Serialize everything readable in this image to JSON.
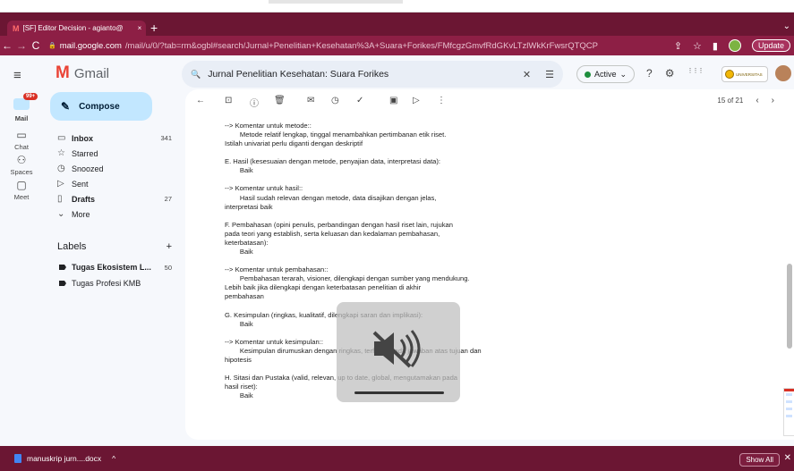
{
  "browser": {
    "tab_title": "[SF] Editor Decision - agianto@",
    "tab_close": "×",
    "new_tab": "+",
    "tab_menu": "⌄",
    "back": "←",
    "forward": "→",
    "reload": "C",
    "lock": "🔒",
    "url_host": "mail.google.com",
    "url_path": "/mail/u/0/?tab=rm&ogbl#search/Jurnal+Penelitian+Kesehatan%3A+Suara+Forikes/FMfcgzGmvfRdGKvLTzlWkKrFwsrQTQCP",
    "update_label": "Update",
    "share_icon": "⇪",
    "star_icon": "☆",
    "sidebar_icon": "▮",
    "menu_icon": "⋮"
  },
  "rail": {
    "menu": "≡",
    "mail_badge": "99+",
    "items": [
      {
        "icon": "✉",
        "label": "Mail"
      },
      {
        "icon": "▭",
        "label": "Chat"
      },
      {
        "icon": "⚇",
        "label": "Spaces"
      },
      {
        "icon": "▢",
        "label": "Meet"
      }
    ]
  },
  "gmail": {
    "logo_m": "M",
    "logo_text": "Gmail",
    "compose_icon": "✎",
    "compose_label": "Compose",
    "folders": [
      {
        "icon": "▭",
        "label": "Inbox",
        "count": "341",
        "bold": true
      },
      {
        "icon": "☆",
        "label": "Starred",
        "count": "",
        "bold": false
      },
      {
        "icon": "◷",
        "label": "Snoozed",
        "count": "",
        "bold": false
      },
      {
        "icon": "▷",
        "label": "Sent",
        "count": "",
        "bold": false
      },
      {
        "icon": "▯",
        "label": "Drafts",
        "count": "27",
        "bold": true
      },
      {
        "icon": "⌄",
        "label": "More",
        "count": "",
        "bold": false
      }
    ],
    "labels_title": "Labels",
    "labels_add": "+",
    "labels": [
      {
        "name": "Tugas Ekosistem L...",
        "count": "50",
        "bold": true
      },
      {
        "name": "Tugas Profesi KMB",
        "count": "",
        "bold": false
      }
    ]
  },
  "header": {
    "search_icon": "🔍",
    "search_query": "Jurnal Penelitian Kesehatan: Suara Forikes",
    "clear_icon": "✕",
    "filter_icon": "☰",
    "status": "Active",
    "status_chevron": "⌄",
    "help_icon": "?",
    "settings_icon": "⚙",
    "apps_icon": "⋮⋮⋮",
    "org_logo_text": "UNIVERSITAS"
  },
  "toolbar": {
    "back": "←",
    "archive": "⊡",
    "report": "ⓘ",
    "delete": "🗑",
    "mark_unread": "✉",
    "snooze": "◷",
    "add_task": "✓",
    "move": "▣",
    "label": "▷",
    "more": "⋮",
    "pager_text": "15 of 21",
    "prev": "‹",
    "next": "›",
    "colors": {
      "accent": "#8d1f45",
      "chrome_dark": "#6b1633",
      "compose": "#c2e7ff"
    }
  },
  "email": {
    "lines": [
      "--> Komentar untuk metode::",
      "        Metode relatif lengkap, tinggal menambahkan pertimbanan etik riset.",
      "Istilah univariat perlu diganti dengan deskriptif",
      "",
      "E. Hasil (kesesuaian dengan metode, penyajian data, interpretasi data):",
      "        Baik",
      "",
      "--> Komentar untuk hasil::",
      "        Hasil sudah relevan dengan metode, data disajikan dengan jelas,",
      "interpretasi baik",
      "",
      "F. Pembahasan (opini penulis, perbandingan dengan hasil riset lain, rujukan",
      "pada teori yang establish, serta keluasan dan kedalaman pembahasan,",
      "keterbatasan):",
      "        Baik",
      "",
      "--> Komentar untuk pembahasan::",
      "        Pembahasan terarah, visioner, dilengkapi dengan sumber yang mendukung.",
      "Lebih baik jika dilengkapi dengan keterbatasan penelitian di akhir",
      "pembahasan",
      "",
      "G. Kesimpulan (ringkas, kualitatif, dilengkapi saran dan implikasi):",
      "        Baik",
      "",
      "--> Komentar untuk kesimpulan::",
      "        Kesimpulan dirumuskan dengan ringkas, terfokus pada jawaban atas tujuan dan",
      "hipotesis",
      "",
      "H. Sitasi dan Pustaka (valid, relevan, up to date, global, mengutamakan pada",
      "hasil riset):",
      "        Baik"
    ],
    "mute_icon": "speaker-muted-icon"
  },
  "downloads": {
    "file_name": "manuskrip jurn....docx",
    "chevron": "^",
    "show_all": "Show All",
    "close": "✕"
  }
}
